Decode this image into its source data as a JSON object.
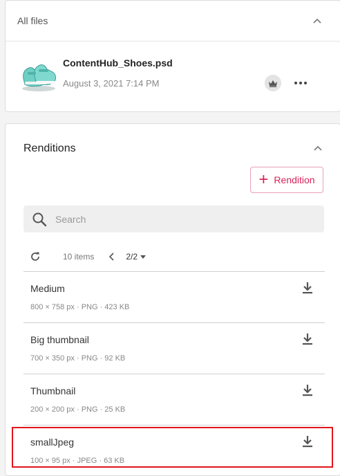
{
  "files_panel": {
    "title": "All files",
    "file": {
      "name": "ContentHub_Shoes.psd",
      "date": "August 3, 2021 7:14 PM"
    }
  },
  "renditions_panel": {
    "title": "Renditions",
    "add_label": "Rendition",
    "search_placeholder": "Search",
    "items_count": "10 items",
    "page": "2/2",
    "items": [
      {
        "name": "Medium",
        "meta": "800 × 758 px · PNG · 423 KB"
      },
      {
        "name": "Big thumbnail",
        "meta": "700 × 350 px · PNG · 92 KB"
      },
      {
        "name": "Thumbnail",
        "meta": "200 × 200 px · PNG · 25 KB"
      },
      {
        "name": "smallJpeg",
        "meta": "100 × 95 px · JPEG · 63 KB"
      }
    ]
  },
  "colors": {
    "accent": "#d8245a",
    "highlight": "#e0161b"
  },
  "icons": [
    "chevron-up-icon",
    "shoes-thumbnail",
    "crown-icon",
    "more-icon",
    "plus-icon",
    "search-icon",
    "refresh-icon",
    "chevron-left-icon",
    "caret-down-icon",
    "download-icon"
  ]
}
